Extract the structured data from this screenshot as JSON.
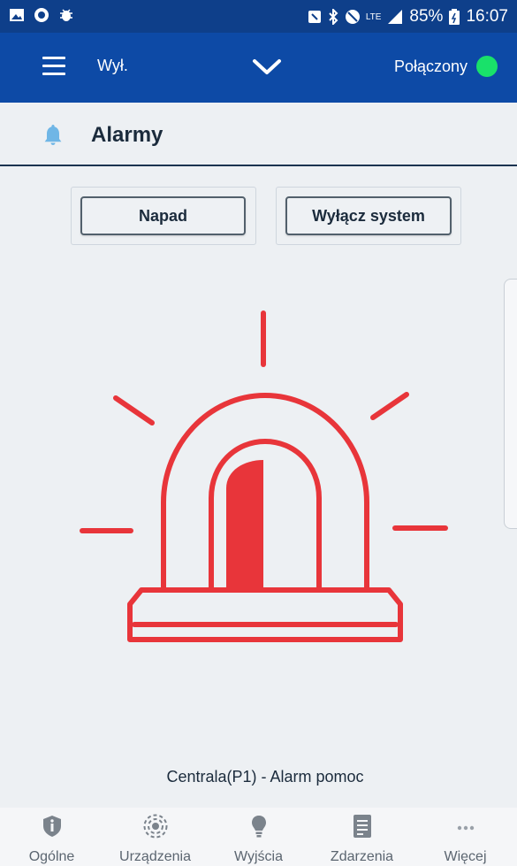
{
  "status_bar": {
    "battery": "85%",
    "time": "16:07",
    "network": "LTE"
  },
  "app_bar": {
    "state": "Wył.",
    "connection": "Połączony",
    "connection_color": "#19e16a"
  },
  "section": {
    "title": "Alarmy",
    "icon": "bell-icon"
  },
  "actions": {
    "attack_label": "Napad",
    "disarm_label": "Wyłącz system"
  },
  "alarm": {
    "icon": "siren-icon",
    "color": "#e8353a",
    "event": "Centrala(P1) - Alarm pomoc"
  },
  "nav": [
    {
      "label": "Ogólne",
      "icon": "shield-info-icon"
    },
    {
      "label": "Urządzenia",
      "icon": "sensor-icon"
    },
    {
      "label": "Wyjścia",
      "icon": "bulb-icon"
    },
    {
      "label": "Zdarzenia",
      "icon": "events-list-icon"
    },
    {
      "label": "Więcej",
      "icon": "more-icon"
    }
  ],
  "colors": {
    "header": "#0d4aa6",
    "statusbar": "#0e3f8a",
    "background": "#edf0f3"
  }
}
